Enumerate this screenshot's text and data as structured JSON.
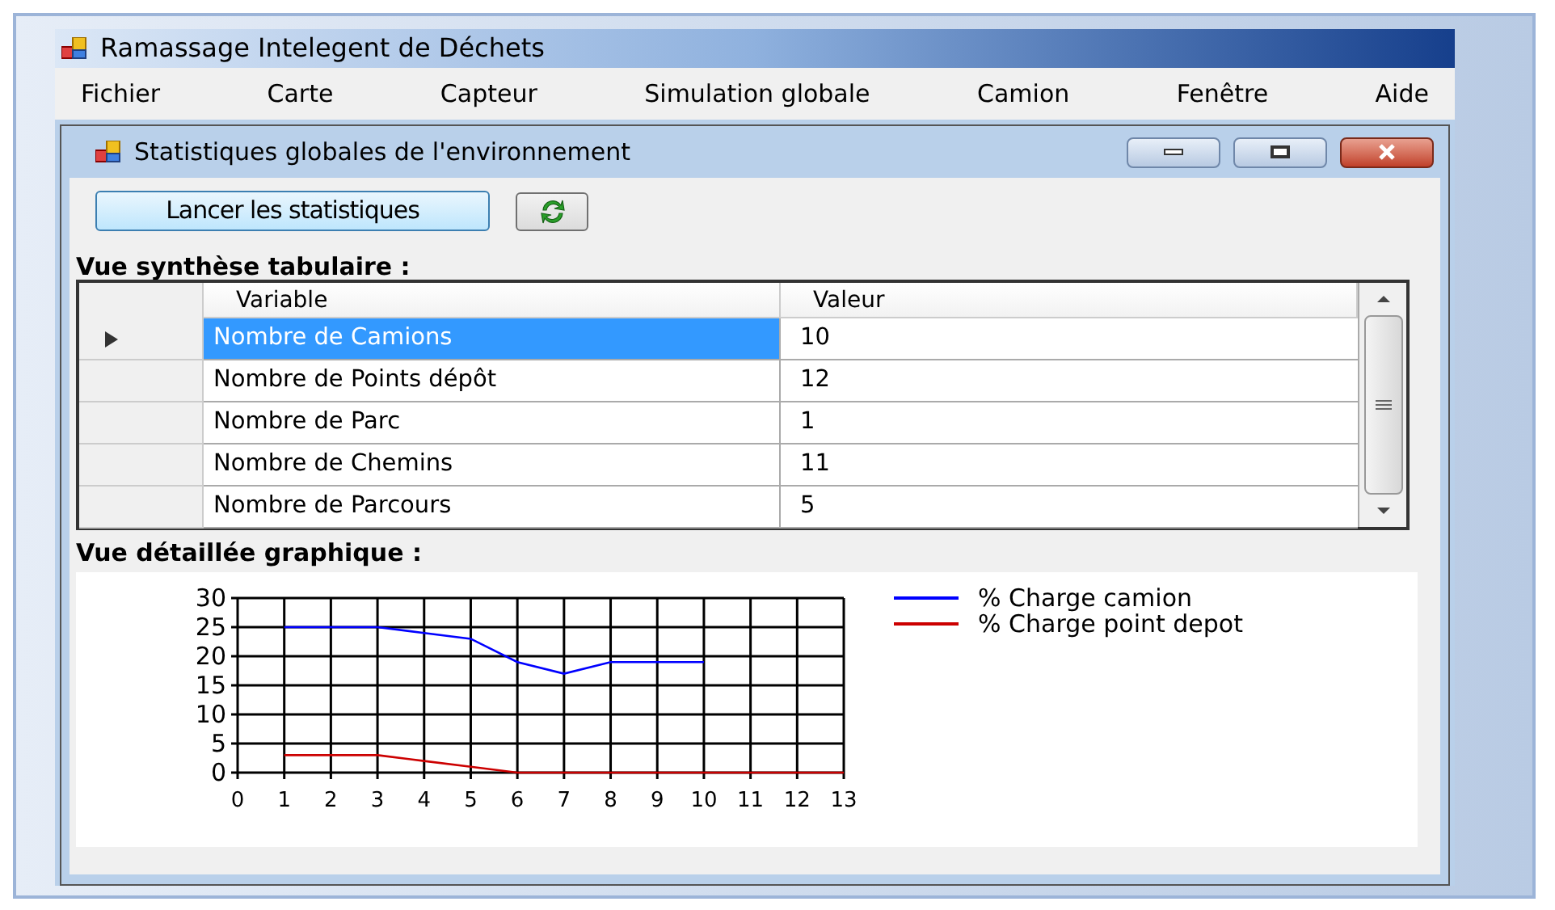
{
  "window": {
    "title": "Ramassage Intelegent de Déchets"
  },
  "menu": [
    "Fichier",
    "Carte",
    "Capteur",
    "Simulation globale",
    "Camion",
    "Fenêtre",
    "Aide"
  ],
  "child_window": {
    "title": "Statistiques globales de l'environnement",
    "toolbar": {
      "run_button": "Lancer les statistiques"
    },
    "table_section": {
      "label": "Vue synthèse tabulaire :",
      "table": {
        "columns": [
          "Variable",
          "Valeur"
        ],
        "rows": [
          {
            "variable": "Nombre de Camions",
            "value": "10",
            "selected": true
          },
          {
            "variable": "Nombre de Points dépôt",
            "value": "12",
            "selected": false
          },
          {
            "variable": "Nombre de Parc",
            "value": "1",
            "selected": false
          },
          {
            "variable": "Nombre de Chemins",
            "value": "11",
            "selected": false
          },
          {
            "variable": "Nombre de Parcours",
            "value": "5",
            "selected": false
          }
        ]
      }
    },
    "chart_section": {
      "label": "Vue détaillée graphique :",
      "chart_data": {
        "type": "line",
        "x": [
          1,
          2,
          3,
          4,
          5,
          6,
          7,
          8,
          9,
          10,
          11,
          12,
          13
        ],
        "series": [
          {
            "name": "% Charge camion",
            "color": "#0000ff",
            "values": [
              25,
              25,
              25,
              24,
              23,
              19,
              17,
              19,
              19,
              19,
              null,
              null,
              null
            ]
          },
          {
            "name": "% Charge point depot",
            "color": "#cc0000",
            "values": [
              3,
              3,
              3,
              2,
              1,
              0,
              0,
              0,
              0,
              0,
              0,
              0,
              0
            ]
          }
        ],
        "grid": true,
        "legend": true,
        "xlim": [
          0,
          13
        ],
        "ylim": [
          0,
          30
        ],
        "xticks": [
          0,
          1,
          2,
          3,
          4,
          5,
          6,
          7,
          8,
          9,
          10,
          11,
          12,
          13
        ],
        "yticks": [
          0,
          5,
          10,
          15,
          20,
          25,
          30
        ]
      }
    }
  }
}
